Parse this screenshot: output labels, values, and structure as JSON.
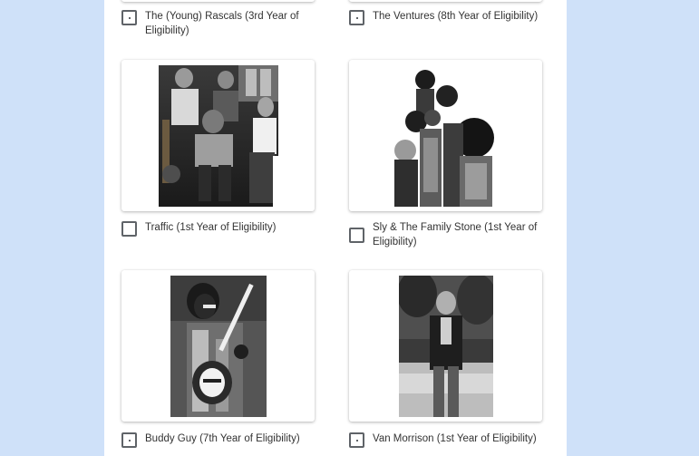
{
  "options": [
    {
      "id": "young-rascals",
      "label": "The (Young) Rascals (3rd Year of Eligibility)",
      "checked": false,
      "image": "band-photo"
    },
    {
      "id": "ventures",
      "label": "The Ventures (8th Year of Eligibility)",
      "checked": false,
      "image": "band-photo"
    },
    {
      "id": "traffic",
      "label": "Traffic (1st Year of Eligibility)",
      "checked": false,
      "image": "band-photo"
    },
    {
      "id": "sly-family-stone",
      "label": "Sly & The Family Stone (1st Year of Eligibility)",
      "checked": false,
      "image": "band-photo"
    },
    {
      "id": "buddy-guy",
      "label": "Buddy Guy (7th Year of Eligibility)",
      "checked": false,
      "image": "guitarist-photo"
    },
    {
      "id": "van-morrison",
      "label": "Van Morrison (1st Year of Eligibility)",
      "checked": false,
      "image": "portrait-photo"
    }
  ],
  "colors": {
    "background": "#cfe1f9",
    "panel": "#ffffff",
    "checkbox_border": "#5f6368",
    "text": "#333333"
  }
}
